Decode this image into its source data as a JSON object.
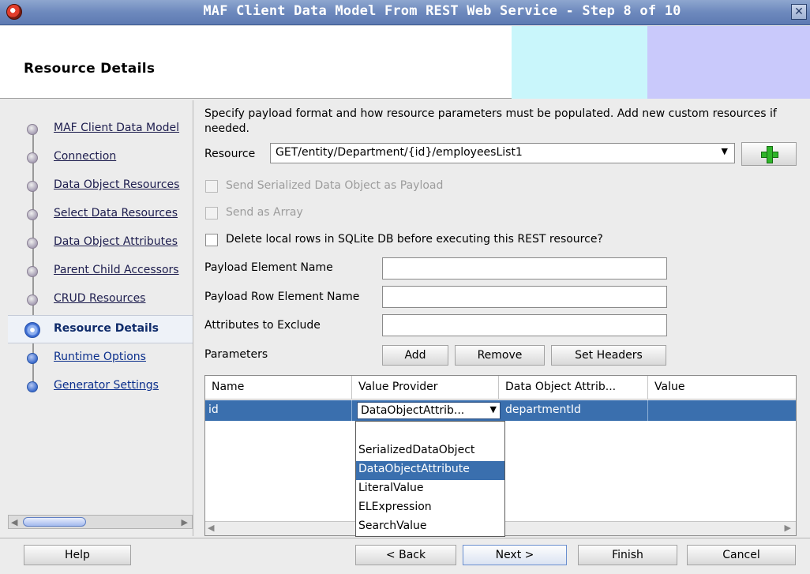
{
  "window": {
    "title": "MAF Client Data Model From REST Web Service - Step 8 of 10"
  },
  "header": {
    "title": "Resource Details"
  },
  "nav": {
    "items": [
      {
        "label": "MAF Client Data Model"
      },
      {
        "label": "Connection"
      },
      {
        "label": "Data Object Resources"
      },
      {
        "label": "Select Data Resources"
      },
      {
        "label": "Data Object Attributes"
      },
      {
        "label": "Parent Child Accessors"
      },
      {
        "label": "CRUD Resources"
      },
      {
        "label": "Resource Details"
      },
      {
        "label": "Runtime Options"
      },
      {
        "label": "Generator Settings"
      }
    ],
    "current_index": 7
  },
  "main": {
    "description": "Specify payload format and how resource parameters must be populated. Add new custom resources if needed.",
    "resource_label": "Resource",
    "resource_value": "GET/entity/Department/{id}/employeesList1",
    "checkbox_serialized": "Send Serialized Data Object as Payload",
    "checkbox_array": "Send as Array",
    "checkbox_delete": "Delete local rows in SQLite DB before executing this REST resource?",
    "payload_element_label": "Payload Element Name",
    "payload_row_element_label": "Payload Row Element Name",
    "attributes_exclude_label": "Attributes to Exclude",
    "parameters_label": "Parameters",
    "add_label": "Add",
    "remove_label": "Remove",
    "set_headers_label": "Set Headers"
  },
  "table": {
    "columns": [
      "Name",
      "Value Provider",
      "Data Object Attrib...",
      "Value"
    ],
    "rows": [
      {
        "name": "id",
        "value_provider": "DataObjectAttrib...",
        "data_object_attribute": "departmentId",
        "value": ""
      }
    ]
  },
  "dropdown": {
    "options": [
      "",
      "SerializedDataObject",
      "DataObjectAttribute",
      "LiteralValue",
      "ELExpression",
      "SearchValue"
    ],
    "selected": "DataObjectAttribute"
  },
  "footer": {
    "help": "Help",
    "back": "< Back",
    "next": "Next >",
    "finish": "Finish",
    "cancel": "Cancel"
  },
  "colors": {
    "title_bar": "#6d89bd",
    "selection": "#3a6fae",
    "header_band_1": "#c9f6fb",
    "header_band_2": "#c9c9fb"
  }
}
